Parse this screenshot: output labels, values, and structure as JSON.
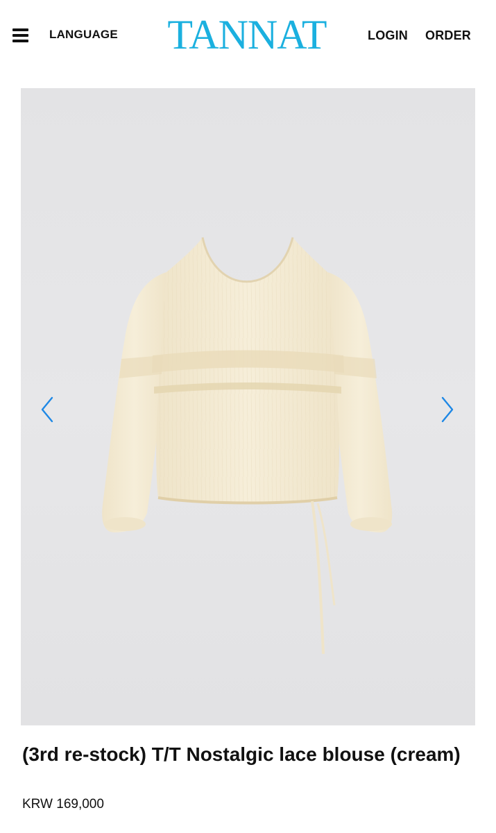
{
  "header": {
    "language_label": "LANGUAGE",
    "logo_text": "TANNAT",
    "login_label": "LOGIN",
    "order_label": "ORDER"
  },
  "product": {
    "title": "(3rd re-stock) T/T Nostalgic lace blouse (cream)",
    "price": "KRW 169,000"
  },
  "icons": {
    "menu": "hamburger-menu-icon",
    "prev": "chevron-left-icon",
    "next": "chevron-right-icon"
  },
  "colors": {
    "logo": "#1bb0df",
    "arrows": "#1e88e5",
    "gallery_background": "#e5e5e7",
    "blouse": "#f3ead4"
  }
}
